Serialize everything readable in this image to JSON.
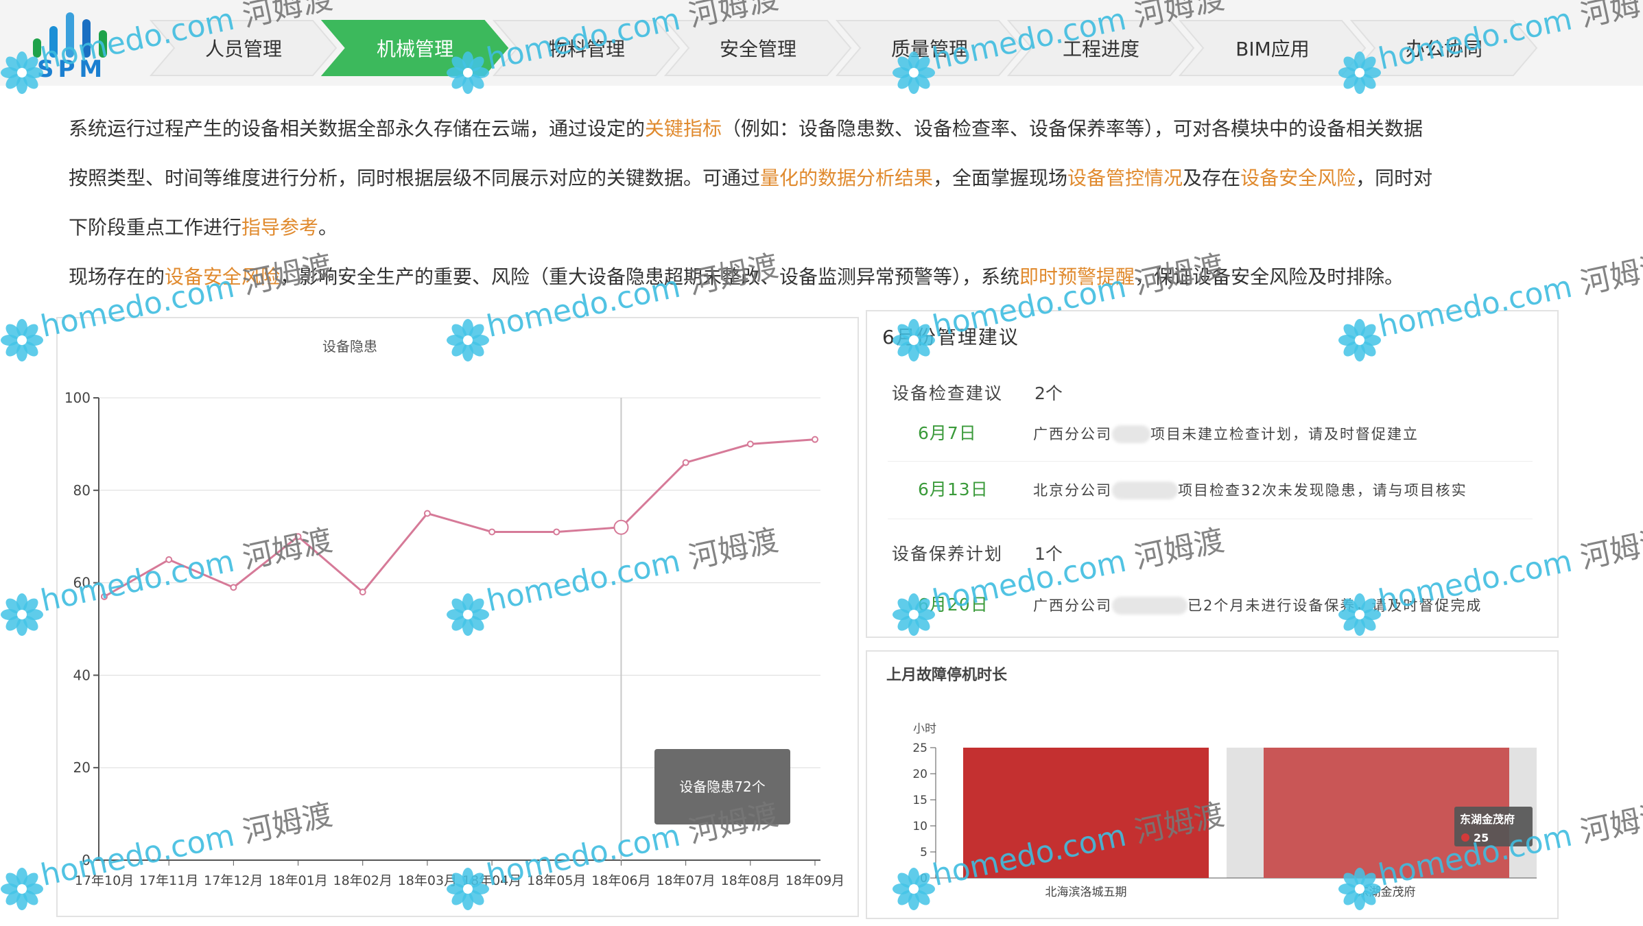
{
  "brand": {
    "logo_text": "SPM",
    "logo_colors": [
      "#1fa24a",
      "#1b8fd6",
      "#3aa0dc",
      "#1b6fc2",
      "#1fa24a"
    ]
  },
  "nav": {
    "active_color": "#3cb95c",
    "tabs": [
      {
        "label": "人员管理"
      },
      {
        "label": "机械管理",
        "active": true
      },
      {
        "label": "物料管理"
      },
      {
        "label": "安全管理"
      },
      {
        "label": "质量管理"
      },
      {
        "label": "工程进度"
      },
      {
        "label": "BIM应用"
      },
      {
        "label": "办公协同"
      }
    ]
  },
  "intro": {
    "line1_a": "系统运行过程产生的设备相关数据全部永久存储在云端，通过设定的",
    "line1_hl": "关键指标",
    "line1_b": "（例如：设备隐患数、设备检查率、设备保养率等），可对各模块中的设备相关数据",
    "line2_a": "按照类型、时间等维度进行分析，同时根据层级不同展示对应的关键数据。可通过",
    "line2_hl1": "量化的数据分析结果",
    "line2_b": "，全面掌握现场",
    "line2_hl2": "设备管控情况",
    "line2_c": "及存在",
    "line2_hl3": "设备安全风险",
    "line2_d": "，同时对",
    "line3_a": "下阶段重点工作进行",
    "line3_hl": "指导参考",
    "line3_b": "。",
    "line4_a": "现场存在的",
    "line4_hl1": "设备安全风险",
    "line4_b": "，影响安全生产的重要、风险（重大设备隐患超期未整改、设备监测异常预警等），系统",
    "line4_hl2": "即时预警提醒",
    "line4_c": "，保证设备安全风险及时排除。",
    "highlight_color": "#e08a2e"
  },
  "line_chart": {
    "chart_data": {
      "type": "line",
      "title": "设备隐患",
      "categories": [
        "17年10月",
        "17年11月",
        "17年12月",
        "18年01月",
        "18年02月",
        "18年03月",
        "18年04月",
        "18年05月",
        "18年06月",
        "18年07月",
        "18年08月",
        "18年09月"
      ],
      "series": [
        {
          "values": [
            57,
            65,
            59,
            70,
            58,
            75,
            71,
            71,
            72,
            86,
            90,
            91
          ]
        }
      ],
      "ylim": [
        0,
        100
      ],
      "yticks": [
        0,
        20,
        40,
        60,
        80,
        100
      ],
      "grid": true,
      "line_color": "#d67a98"
    },
    "tooltip": {
      "text": "设备隐患72个"
    }
  },
  "advice": {
    "title": "6月份管理建议",
    "sections": [
      {
        "label": "设备检查建议",
        "count": "2个",
        "items": [
          {
            "date": "6月7日",
            "prefix": "广西分公司",
            "text": "项目未建立检查计划，请及时督促建立"
          },
          {
            "date": "6月13日",
            "prefix": "北京分公司",
            "text": "项目检查32次未发现隐患，请与项目核实"
          }
        ]
      },
      {
        "label": "设备保养计划",
        "count": "1个",
        "items": [
          {
            "date": "6月20日",
            "prefix": "广西分公司",
            "text": "已2个月未进行设备保养，请及时督促完成"
          }
        ]
      }
    ]
  },
  "bar_chart": {
    "title": "上月故障停机时长",
    "chart_data": {
      "type": "bar",
      "ylabel": "小时",
      "categories": [
        "北海滨洛城五期",
        "东湖金茂府"
      ],
      "values": [
        25,
        25
      ],
      "ylim": [
        0,
        25
      ],
      "yticks": [
        0,
        5,
        10,
        15,
        20,
        25
      ],
      "colors": [
        "#c43030",
        "#c95656"
      ]
    },
    "tooltip": {
      "name": "东湖金茂府",
      "value": "25"
    }
  },
  "watermark": {
    "text": "homedo.com",
    "cn": "河姆渡"
  }
}
